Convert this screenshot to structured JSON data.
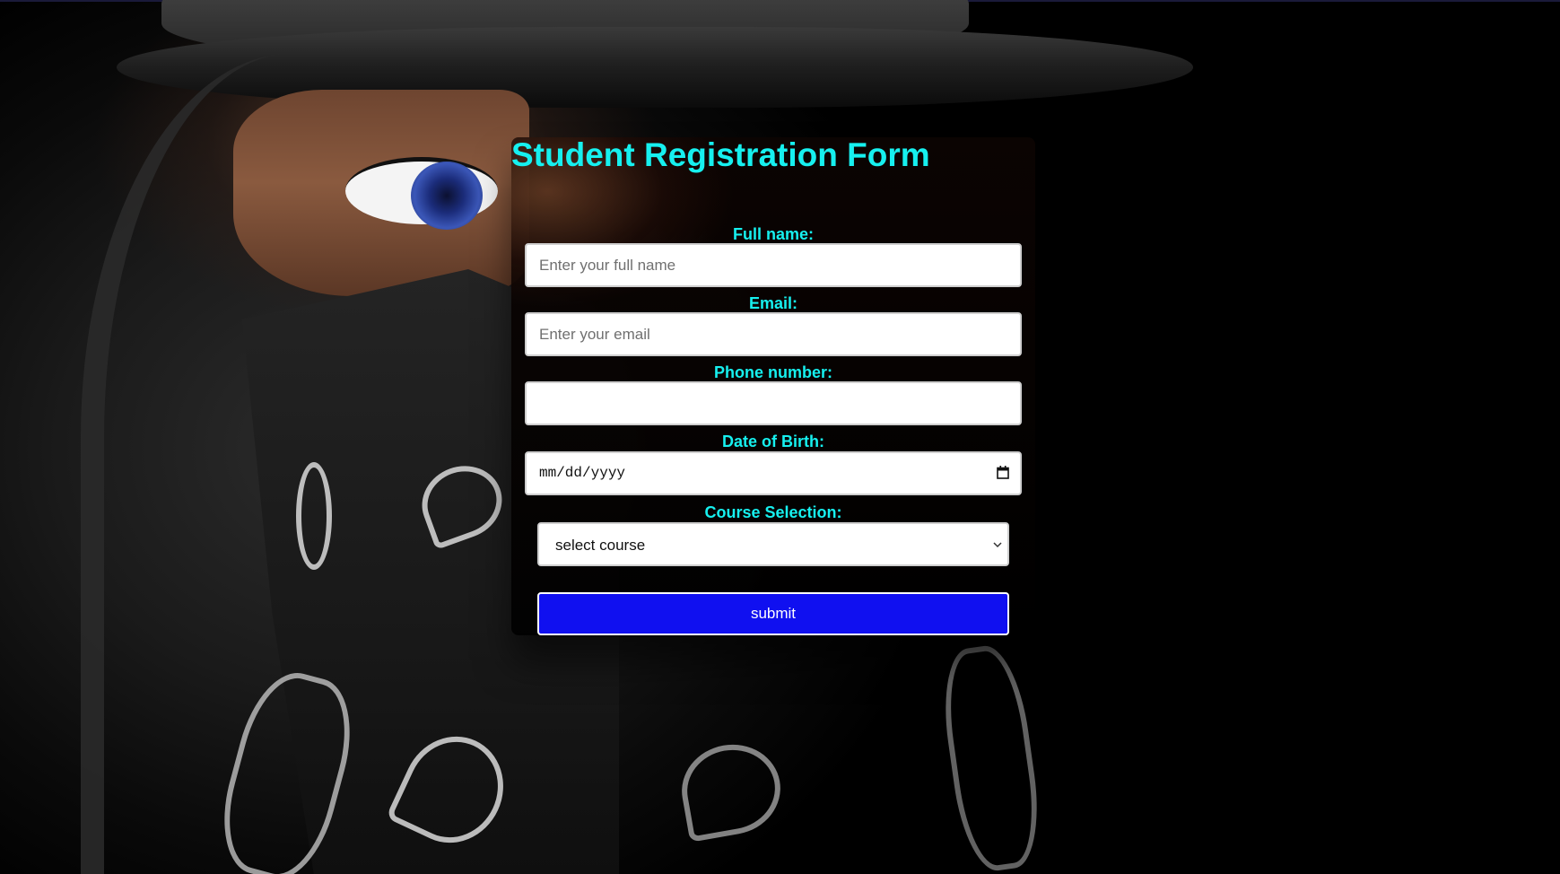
{
  "form": {
    "title": "Student Registration Form",
    "fields": {
      "full_name": {
        "label": "Full name:",
        "placeholder": "Enter your full name",
        "value": ""
      },
      "email": {
        "label": "Email:",
        "placeholder": "Enter your email",
        "value": ""
      },
      "phone": {
        "label": "Phone number:",
        "placeholder": "",
        "value": ""
      },
      "dob": {
        "label": "Date of Birth:",
        "display": "mm/dd/yyyy"
      },
      "course": {
        "label": "Course Selection:",
        "selected": "select course"
      }
    },
    "submit_label": "submit"
  },
  "colors": {
    "label_cyan": "#16f0ef",
    "submit_blue": "#1010f0"
  },
  "icons": {
    "date": "calendar-icon",
    "select": "chevron-down-icon"
  }
}
